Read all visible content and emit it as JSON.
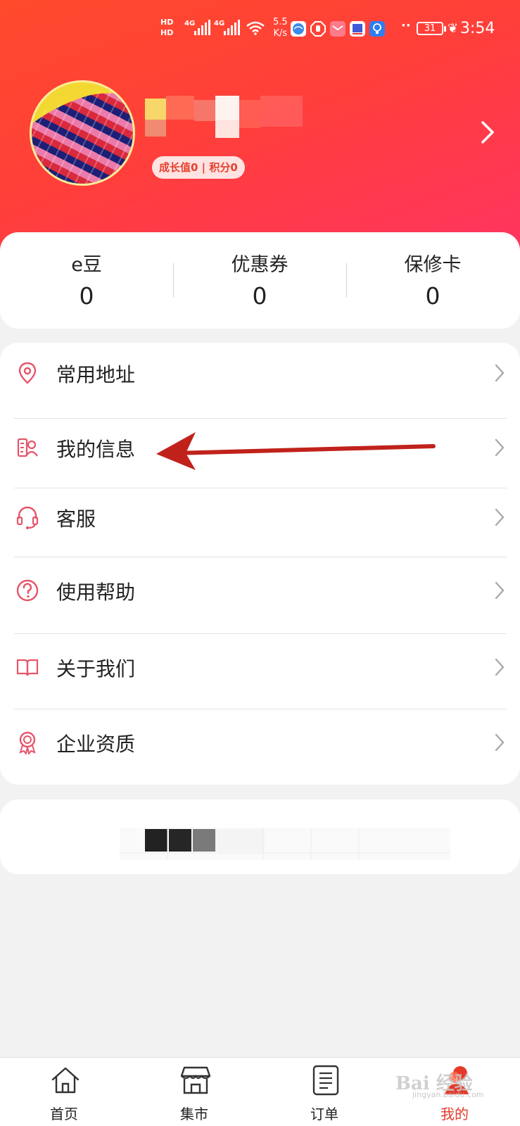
{
  "status_bar": {
    "network_labels": [
      "HD",
      "HD"
    ],
    "signal_1": "4G",
    "signal_2": "4G",
    "speed_value": "5.5",
    "speed_unit": "K/s",
    "dots": "··",
    "battery": "31",
    "time": "3:54"
  },
  "profile": {
    "growth_badge": "成长值0 | 积分0"
  },
  "stats": [
    {
      "label": "e豆",
      "value": "0"
    },
    {
      "label": "优惠券",
      "value": "0"
    },
    {
      "label": "保修卡",
      "value": "0"
    }
  ],
  "menu": [
    {
      "label": "常用地址",
      "icon": "location-pin-icon"
    },
    {
      "label": "我的信息",
      "icon": "user-info-icon"
    },
    {
      "label": "客服",
      "icon": "headset-icon"
    },
    {
      "label": "使用帮助",
      "icon": "question-circle-icon"
    },
    {
      "label": "关于我们",
      "icon": "open-book-icon"
    },
    {
      "label": "企业资质",
      "icon": "award-ribbon-icon"
    }
  ],
  "nav": [
    {
      "label": "首页",
      "icon": "home-icon"
    },
    {
      "label": "集市",
      "icon": "store-icon"
    },
    {
      "label": "订单",
      "icon": "order-list-icon"
    },
    {
      "label": "我的",
      "icon": "profile-icon"
    }
  ],
  "watermark": {
    "text": "Bai 经验",
    "sub": "jingyan.baidu.com"
  },
  "colors": {
    "header_start": "#ff4a2c",
    "header_end": "#ff3462",
    "accent": "#e53a2a",
    "icon": "#e5546a",
    "annotation_arrow": "#c0221b"
  }
}
